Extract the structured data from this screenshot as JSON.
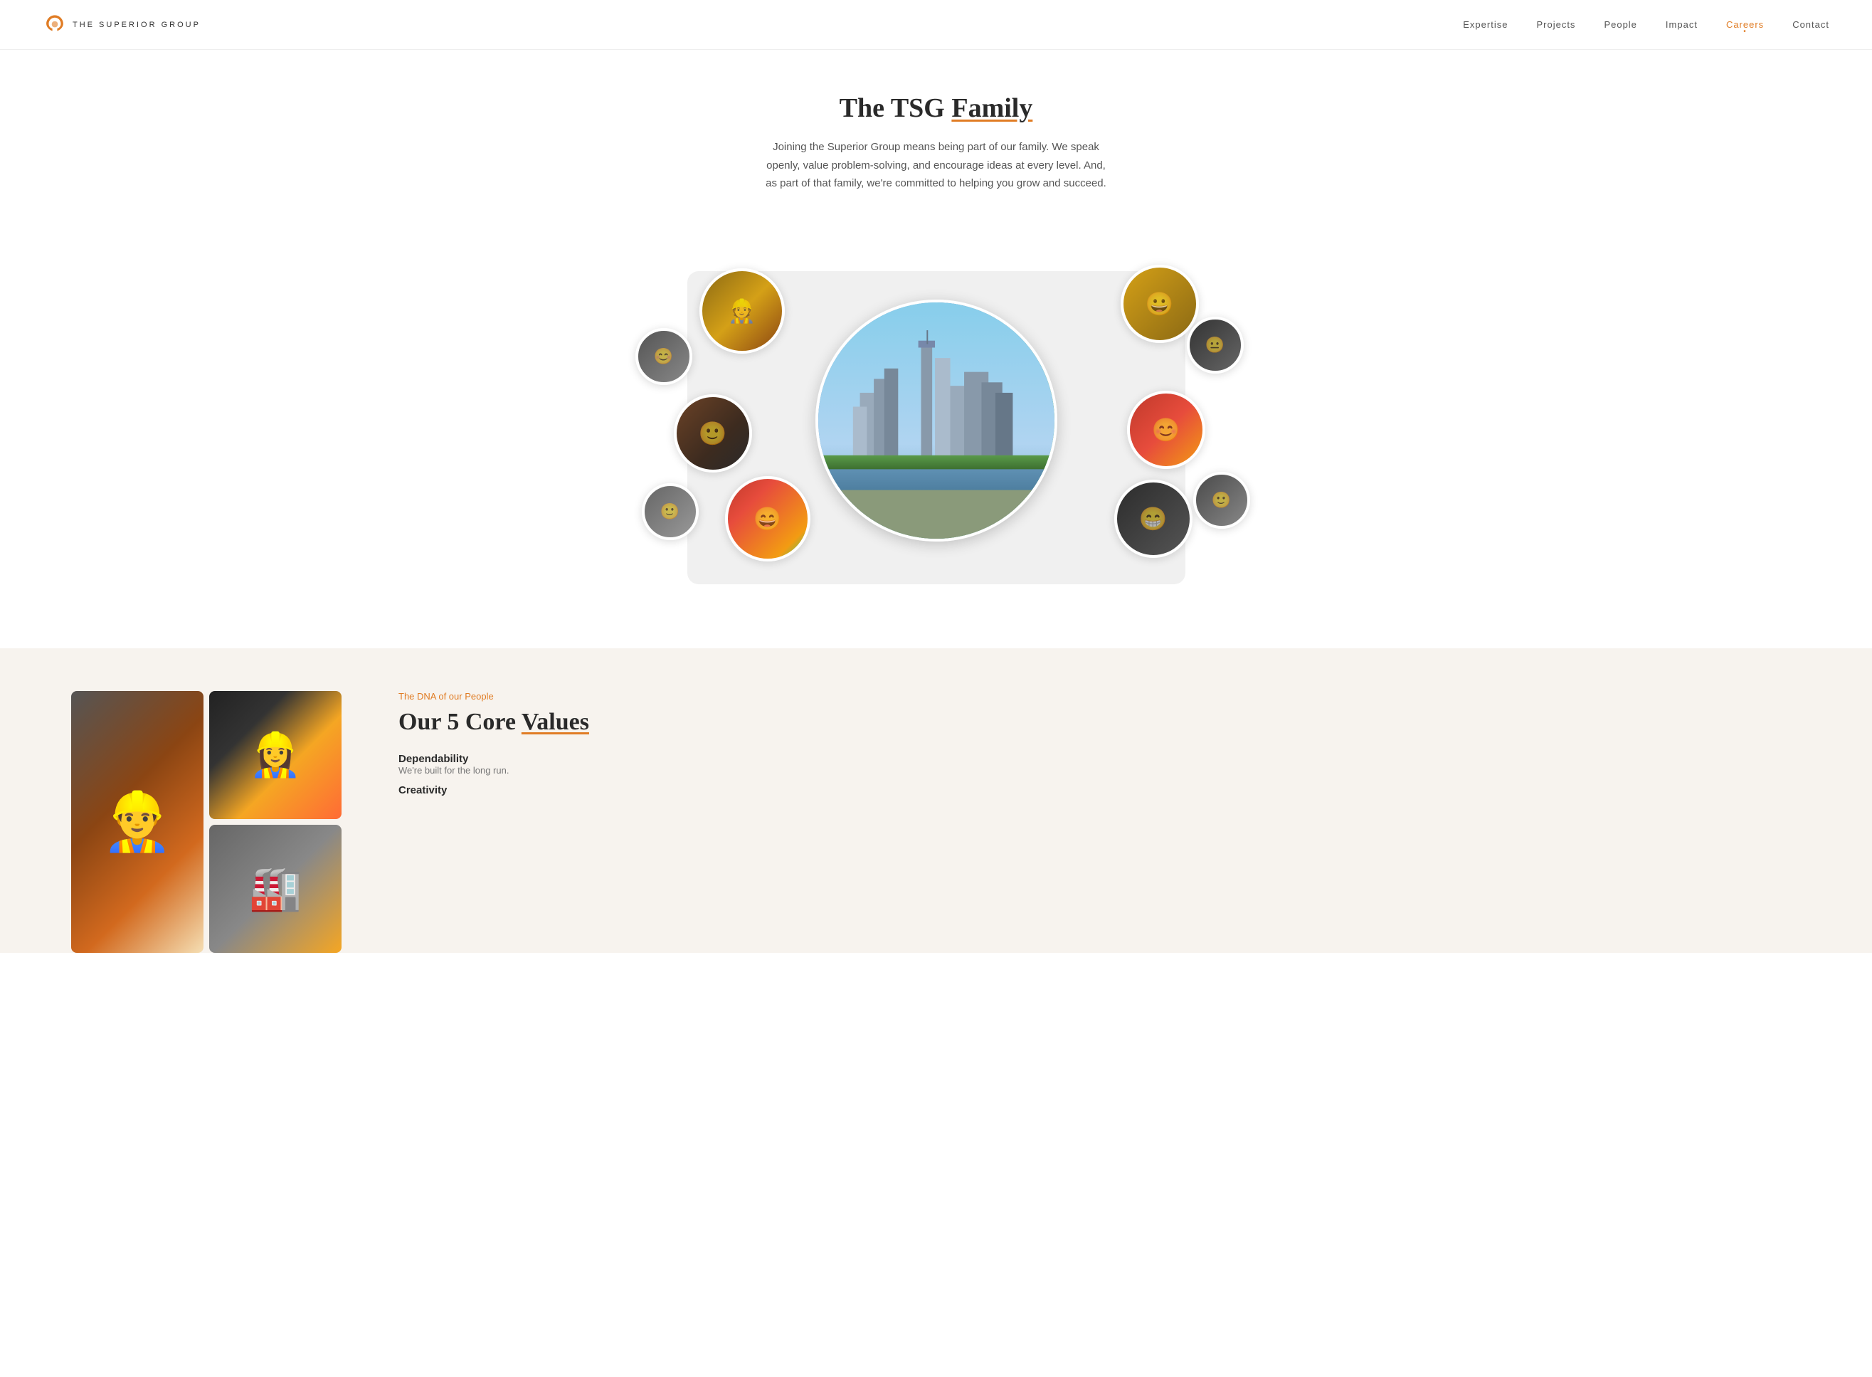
{
  "header": {
    "logo_text": "The Superior Group",
    "nav": [
      {
        "label": "Expertise",
        "active": false
      },
      {
        "label": "Projects",
        "active": false
      },
      {
        "label": "People",
        "active": false
      },
      {
        "label": "Impact",
        "active": false
      },
      {
        "label": "Careers",
        "active": true
      },
      {
        "label": "Contact",
        "active": false
      }
    ]
  },
  "hero": {
    "title_start": "The TSG ",
    "title_highlight": "Family",
    "description": "Joining the Superior Group means being part of our family. We speak openly, value problem-solving, and encourage ideas at every level. And, as part of that family, we're committed to helping you grow and succeed."
  },
  "values": {
    "label": "The DNA of our People",
    "title_start": "Our 5 Core ",
    "title_highlight": "Values",
    "items": [
      {
        "name": "Dependability",
        "desc": "We're built for the long run."
      },
      {
        "name": "Creativity",
        "desc": ""
      }
    ]
  }
}
